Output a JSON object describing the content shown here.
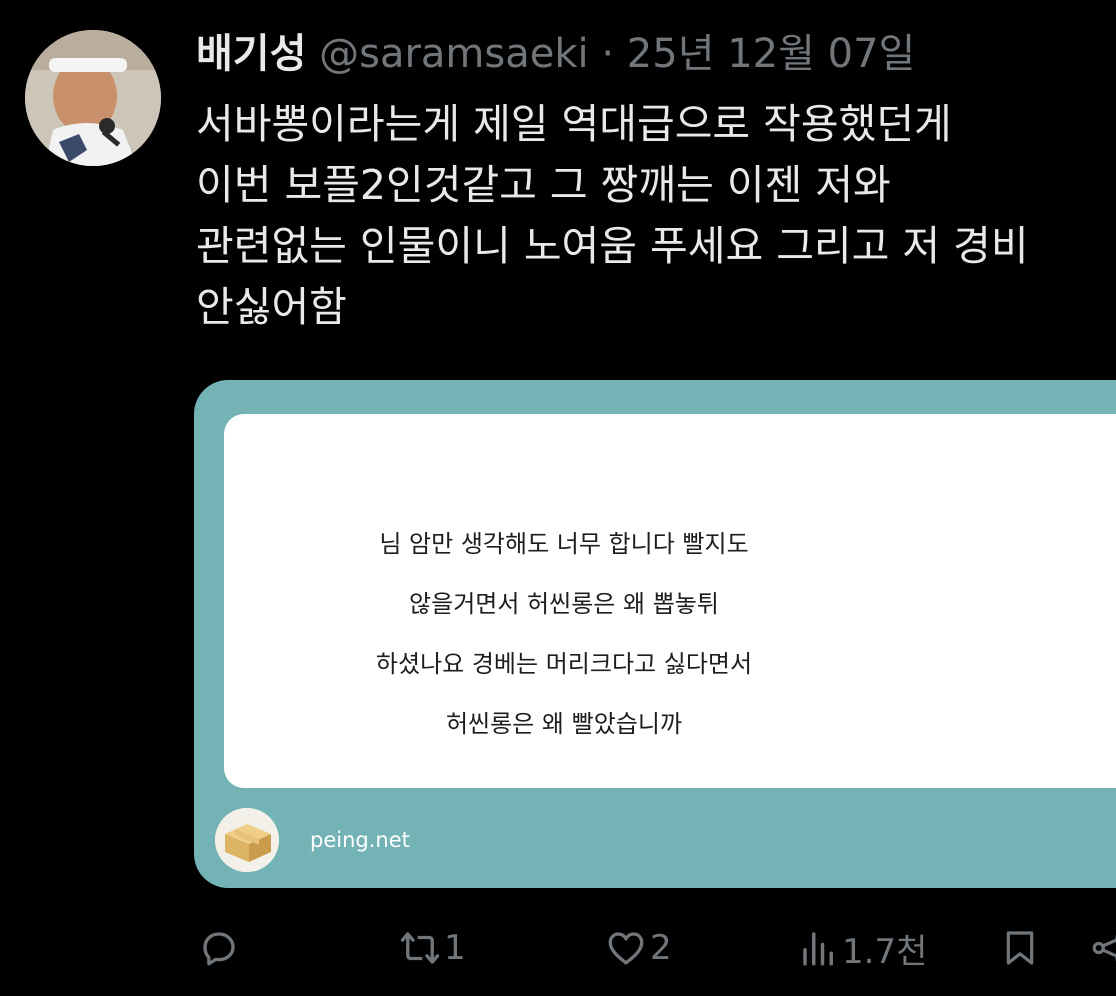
{
  "author": {
    "name": "배기성",
    "handle": "@saramsaeki",
    "separator": "·",
    "date": "25년 12월 07일"
  },
  "post": {
    "lines": [
      "서바뽕이라는게 제일 역대급으로 작용했던게",
      "이번 보플2인것같고 그 짱깨는 이젠 저와",
      "관련없는 인물이니 노여움 푸세요 그리고 저 경비",
      "안싫어함"
    ]
  },
  "card": {
    "background_color": "#74b3b5",
    "question_lines": [
      "님 암만 생각해도 너무 합니다 빨지도",
      "않을거면서 허씬롱은 왜 뽑놓튀",
      "하셨나요 경베는 머리크다고 싫다면서",
      "허씬롱은 왜 빨았습니까"
    ],
    "domain": "peing.net"
  },
  "actions": {
    "reply_icon": "reply-icon",
    "retweet_icon": "retweet-icon",
    "retweet_count": "1",
    "like_icon": "heart-icon",
    "like_count": "2",
    "views_icon": "views-icon",
    "views_count": "1.7천",
    "bookmark_icon": "bookmark-icon",
    "share_icon": "share-icon"
  }
}
